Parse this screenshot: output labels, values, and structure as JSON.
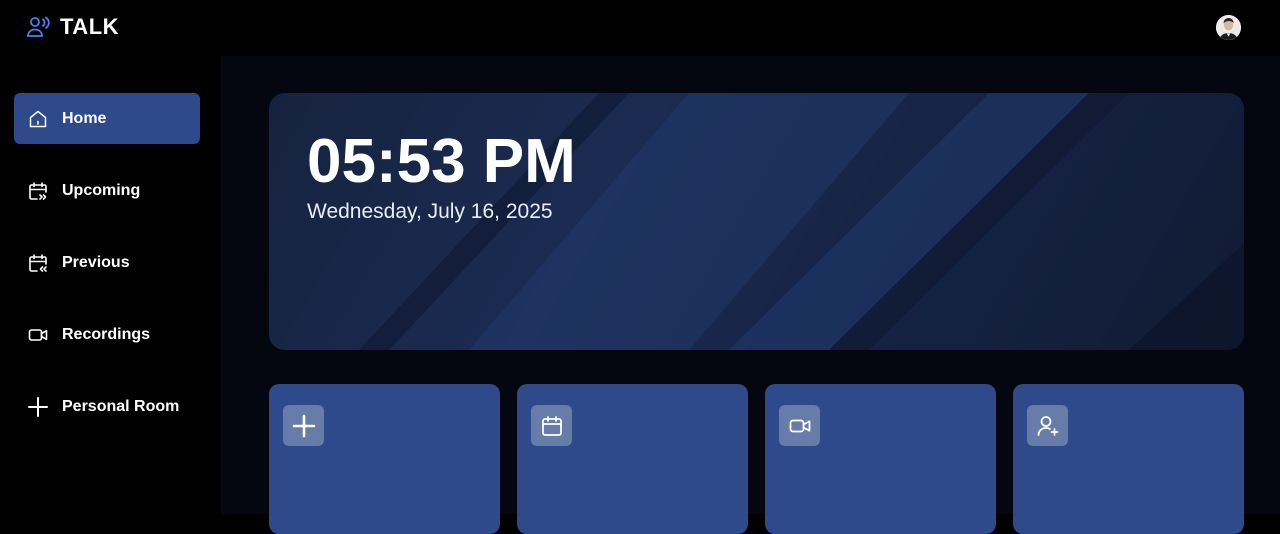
{
  "app": {
    "brand_name": "TALK",
    "brand_icon": "user-voice-icon",
    "accent_color": "#2e4a8a"
  },
  "header": {
    "avatar_icon": "user-avatar"
  },
  "sidebar": {
    "items": [
      {
        "label": "Home",
        "icon": "home-icon",
        "active": true
      },
      {
        "label": "Upcoming",
        "icon": "calendar-forward-icon",
        "active": false
      },
      {
        "label": "Previous",
        "icon": "calendar-back-icon",
        "active": false
      },
      {
        "label": "Recordings",
        "icon": "video-icon",
        "active": false
      },
      {
        "label": "Personal Room",
        "icon": "plus-icon",
        "active": false
      }
    ]
  },
  "hero": {
    "time": "05:53 PM",
    "date": "Wednesday, July 16, 2025"
  },
  "cards": [
    {
      "icon": "plus-icon"
    },
    {
      "icon": "calendar-icon"
    },
    {
      "icon": "video-icon"
    },
    {
      "icon": "user-add-icon"
    }
  ]
}
